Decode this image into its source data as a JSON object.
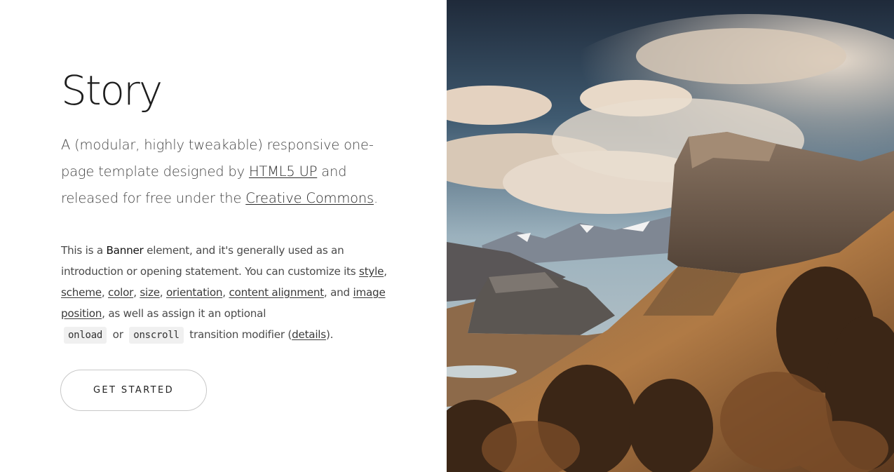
{
  "banner": {
    "title": "Story",
    "major": {
      "t1": "A (modular, highly tweakable) responsive one-page template designed by ",
      "link1": "HTML5 UP",
      "t2": " and released for free under the ",
      "link2": "Creative Commons",
      "t3": "."
    },
    "minor": {
      "t1": "This is a ",
      "bold": "Banner",
      "t2": " element, and it's generally used as an introduction or opening statement. You can customize its ",
      "l_style": "style",
      "c1": ", ",
      "l_scheme": "scheme",
      "c2": ", ",
      "l_color": "color",
      "c3": ", ",
      "l_size": "size",
      "c4": ", ",
      "l_orientation": "orientation",
      "c5": ", ",
      "l_alignment": "content alignment",
      "c6": ", and ",
      "l_imagepos": "image position",
      "t3": ", as well as assign it an optional",
      "code1": "onload",
      "or": "or",
      "code2": "onscroll",
      "t4": "transition modifier (",
      "l_details": "details",
      "t5": ")."
    },
    "button_label": "GET STARTED"
  },
  "image": {
    "icon": "mountain-landscape-photo",
    "colors": {
      "sky": "#3c5266",
      "cloud": "#e6d8c8",
      "rock": "#6b5444",
      "grass": "#a9713f"
    }
  }
}
